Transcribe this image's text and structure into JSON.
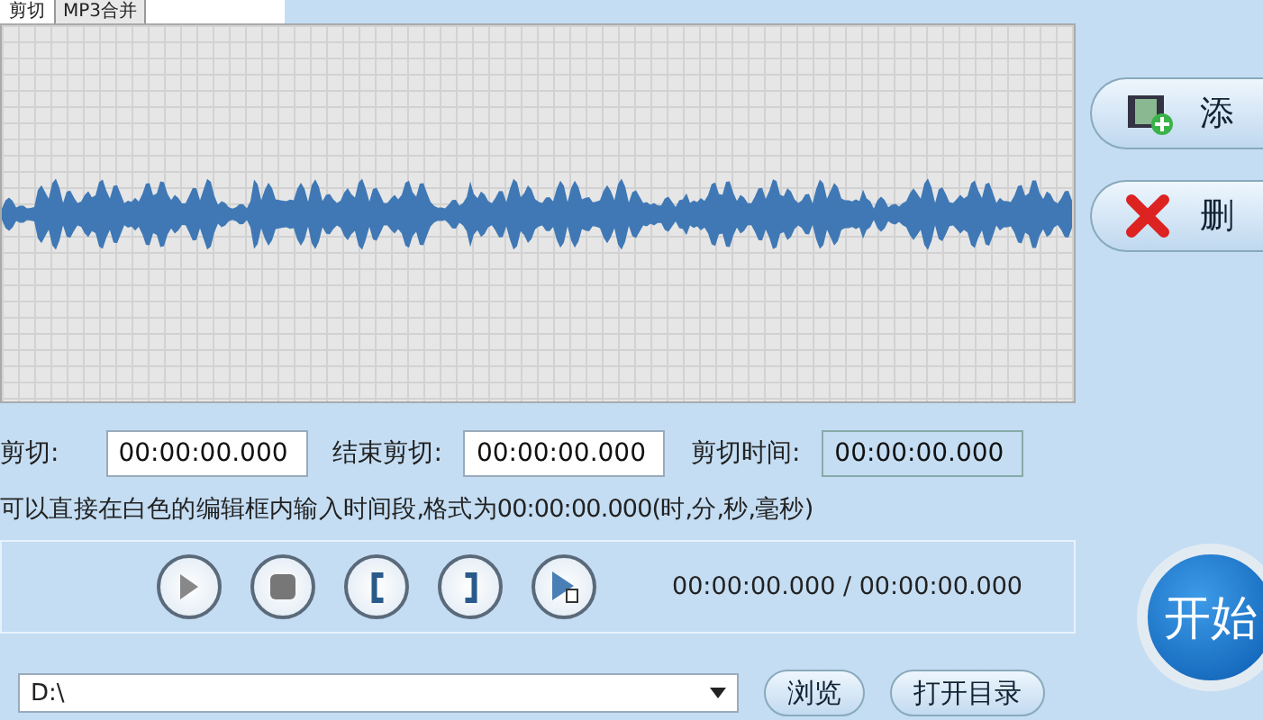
{
  "tabs": [
    {
      "label": "剪切",
      "selected": true
    },
    {
      "label": "MP3合并",
      "selected": false
    }
  ],
  "side_buttons": [
    {
      "label": "添",
      "kind": "add"
    },
    {
      "label": "删",
      "kind": "delete"
    }
  ],
  "cut_fields": [
    {
      "label": "剪切:",
      "value": "00:00:00.000",
      "editable": true
    },
    {
      "label": "结束剪切:",
      "value": "00:00:00.000",
      "editable": true
    },
    {
      "label": "剪切时间:",
      "value": "00:00:00.000",
      "editable": false
    }
  ],
  "hint": "可以直接在白色的编辑框内输入时间段,格式为00:00:00.000(时,分,秒,毫秒)",
  "player_buttons": [
    {
      "kind": "play"
    },
    {
      "kind": "stop"
    },
    {
      "kind": "mark-start"
    },
    {
      "kind": "mark-end"
    },
    {
      "kind": "play-selection"
    }
  ],
  "player_time": "00:00:00.000 / 00:00:00.000",
  "output_path": "D:\\",
  "path_buttons": [
    "浏览",
    "打开目录"
  ],
  "start_button": "开始"
}
